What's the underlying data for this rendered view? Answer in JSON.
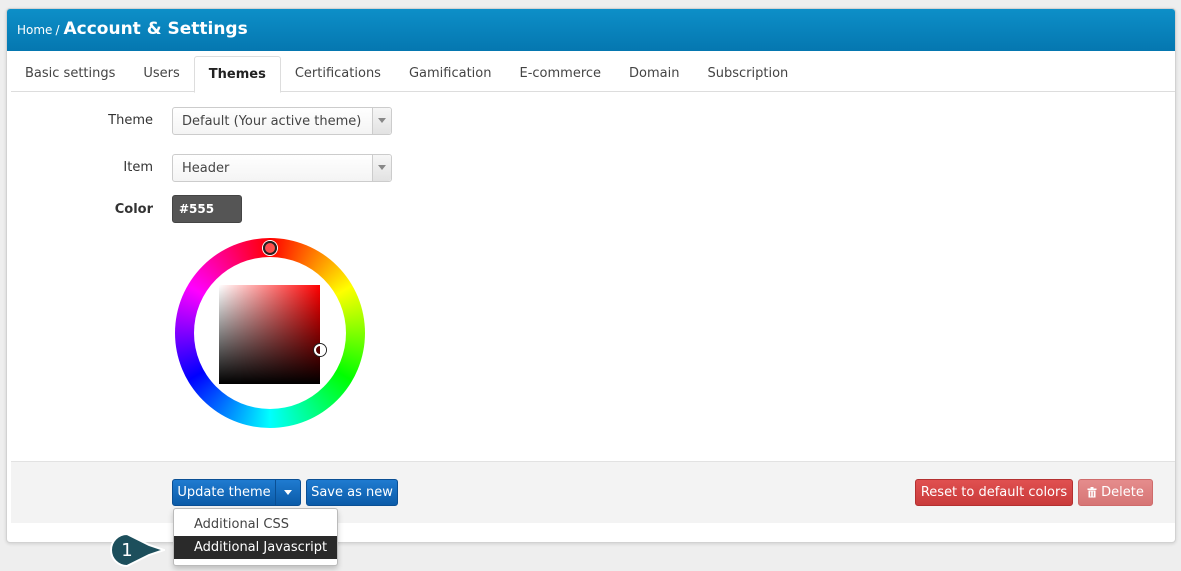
{
  "header": {
    "breadcrumb_home": "Home",
    "breadcrumb_sep": "/",
    "title": "Account & Settings"
  },
  "tabs": [
    {
      "label": "Basic settings"
    },
    {
      "label": "Users"
    },
    {
      "label": "Themes",
      "active": true
    },
    {
      "label": "Certifications"
    },
    {
      "label": "Gamification"
    },
    {
      "label": "E-commerce"
    },
    {
      "label": "Domain"
    },
    {
      "label": "Subscription"
    }
  ],
  "form": {
    "theme_label": "Theme",
    "theme_value": "Default (Your active theme)",
    "item_label": "Item",
    "item_value": "Header",
    "color_label": "Color",
    "color_value": "#555"
  },
  "buttons": {
    "update_theme": "Update theme",
    "save_as_new": "Save as new",
    "reset_default": "Reset to default colors",
    "delete": "Delete"
  },
  "dropdown": {
    "items": [
      "Additional CSS",
      "Additional Javascript"
    ],
    "highlighted_index": 1
  },
  "callout": {
    "number": "1"
  },
  "colors": {
    "header_bg": "#0a84c1",
    "primary": "#1565b8",
    "danger": "#d94444",
    "danger_light": "#de8282",
    "callout": "#1d4f5c"
  }
}
